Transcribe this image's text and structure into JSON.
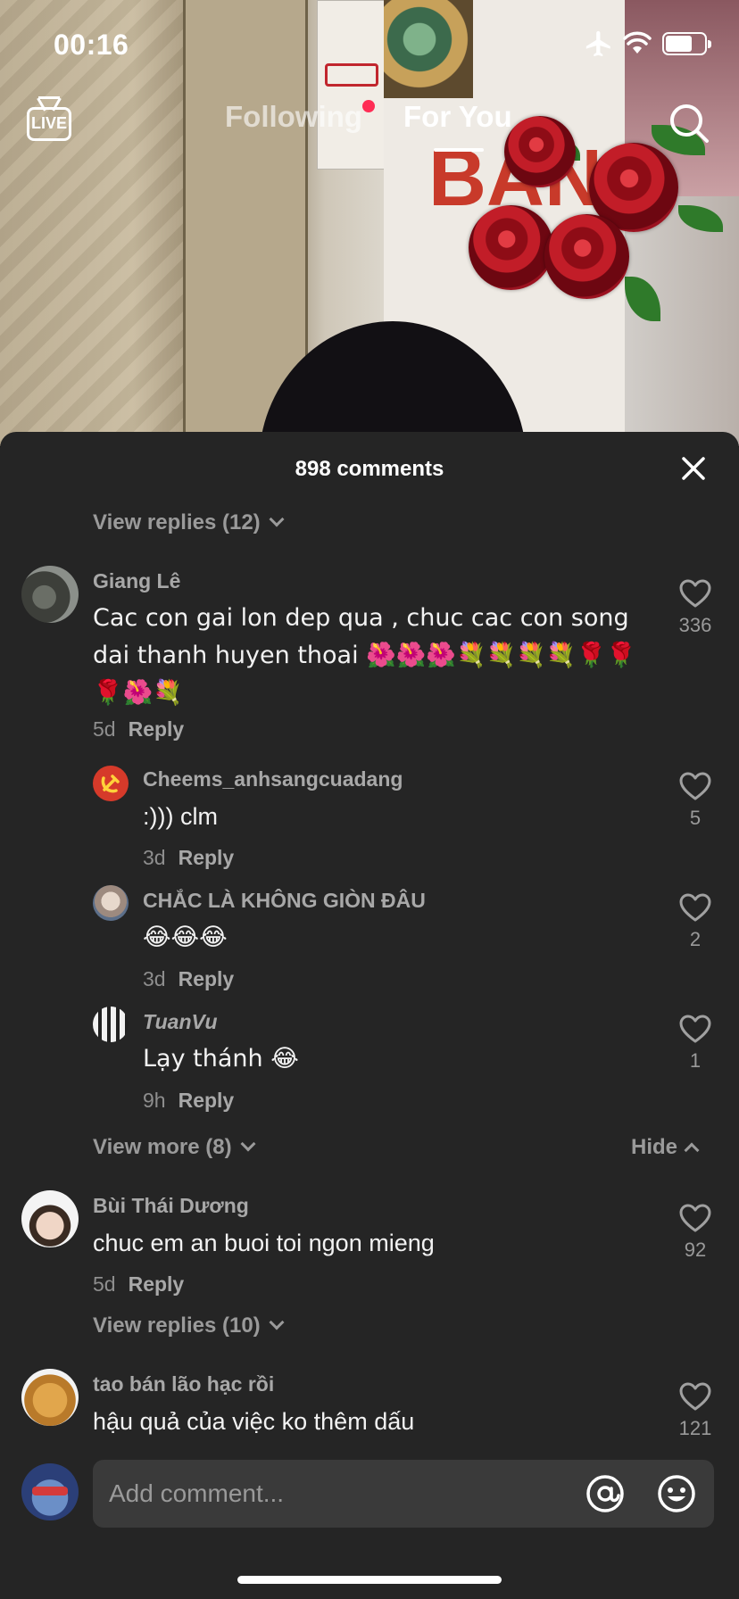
{
  "status_bar": {
    "time": "00:16",
    "icons": [
      "airplane-icon",
      "wifi-icon",
      "battery-icon"
    ]
  },
  "top_nav": {
    "live_label": "LIVE",
    "tabs": [
      {
        "label": "Following",
        "active": false,
        "has_dot": true
      },
      {
        "label": "For You",
        "active": true
      }
    ],
    "search_icon": "search-icon"
  },
  "video_overlay_text": {
    "sign_text": "BÁNH"
  },
  "comments": {
    "title": "898 comments",
    "top_view_replies": "View replies (12)",
    "threads": [
      {
        "username": "Giang Lê",
        "text": "Cac con gai lon dep qua , chuc cac con song dai thanh huyen thoai 🌺🌺🌺💐💐💐💐🌹🌹🌹🌺💐",
        "age": "5d",
        "reply_label": "Reply",
        "likes": "336",
        "replies": [
          {
            "username": "Cheems_anhsangcuadang",
            "text": ":))) clm",
            "age": "3d",
            "reply_label": "Reply",
            "likes": "5"
          },
          {
            "username": "CHẮC LÀ KHÔNG GIÒN ĐÂU",
            "text": "😂😂😂",
            "age": "3d",
            "reply_label": "Reply",
            "likes": "2"
          },
          {
            "username": "TuanVu",
            "text": "Lạy thánh 😂",
            "age": "9h",
            "reply_label": "Reply",
            "likes": "1"
          }
        ],
        "view_more": "View more (8)",
        "hide": "Hide"
      },
      {
        "username": "Bùi Thái Dương",
        "text": "chuc em an buoi toi ngon mieng",
        "age": "5d",
        "reply_label": "Reply",
        "likes": "92",
        "view_replies": "View replies (10)"
      },
      {
        "username": "tao bán lão hạc rồi",
        "text": "hậu quả của việc ko thêm dấu",
        "likes": "121"
      }
    ]
  },
  "input_bar": {
    "placeholder": "Add comment...",
    "icons": [
      "at-mention-icon",
      "emoji-icon"
    ]
  },
  "colors": {
    "sheet_bg": "#252525",
    "input_bg": "#3a3a3a",
    "muted_text": "#9a9a9a",
    "accent_dot": "#ff2d55"
  }
}
